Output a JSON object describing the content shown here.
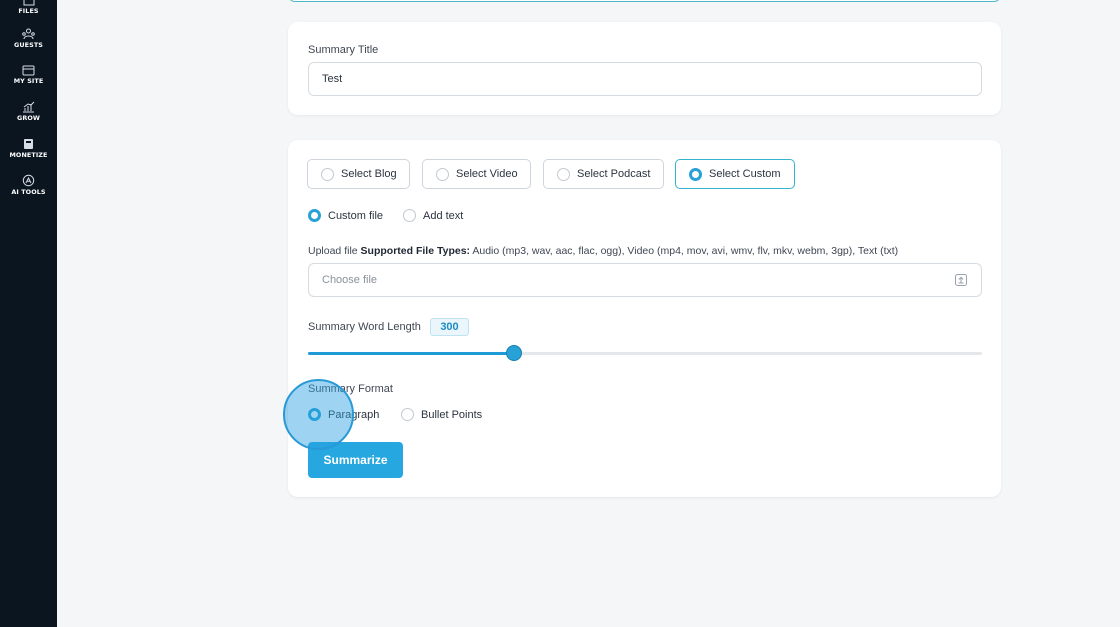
{
  "sidebar": {
    "items": [
      {
        "label": "FILES",
        "icon": "folder-icon"
      },
      {
        "label": "GUESTS",
        "icon": "guests-icon"
      },
      {
        "label": "MY SITE",
        "icon": "browser-window-icon"
      },
      {
        "label": "GROW",
        "icon": "growth-chart-icon"
      },
      {
        "label": "MONETIZE",
        "icon": "monetize-icon"
      },
      {
        "label": "AI TOOLS",
        "icon": "ai-tools-icon"
      }
    ]
  },
  "title_card": {
    "label": "Summary Title",
    "value": "Test"
  },
  "source": {
    "options": [
      "Select Blog",
      "Select Video",
      "Select Podcast",
      "Select Custom"
    ],
    "selected": "Select Custom"
  },
  "input_mode": {
    "options": [
      "Custom file",
      "Add text"
    ],
    "selected": "Custom file"
  },
  "upload": {
    "label": "Upload file",
    "types_heading": "Supported File Types:",
    "types_text": "Audio (mp3, wav, aac, flac, ogg), Video (mp4, mov, avi, wmv, flv, mkv, webm, 3gp), Text (txt)",
    "placeholder": "Choose file"
  },
  "word_length": {
    "label": "Summary Word Length",
    "value": "300",
    "slider_fraction": 0.305
  },
  "format": {
    "label": "Summary Format",
    "options": [
      "Paragraph",
      "Bullet Points"
    ],
    "selected": "Paragraph"
  },
  "actions": {
    "summarize_label": "Summarize"
  },
  "colors": {
    "accent": "#27a1d6",
    "sidebar_bg": "#0b1520",
    "selected_border": "#34b4cf"
  }
}
